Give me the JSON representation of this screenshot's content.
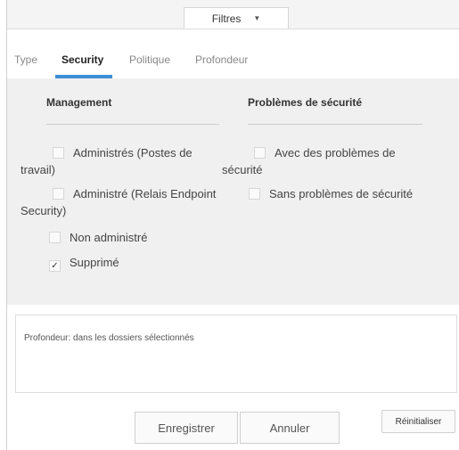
{
  "header": {
    "filter_dropdown": "Filtres",
    "caret_glyph": "▼"
  },
  "tabs": [
    {
      "label": "Type"
    },
    {
      "label": "Security",
      "active": true
    },
    {
      "label": "Politique"
    },
    {
      "label": "Profondeur"
    }
  ],
  "management": {
    "heading": "Management",
    "options": [
      {
        "label": "Administrés (Postes de travail)",
        "checked": false
      },
      {
        "label": "Administré (Relais Endpoint Security)",
        "checked": false
      },
      {
        "label": "Non administré",
        "checked": false
      },
      {
        "label": "Supprimé",
        "checked": true
      }
    ]
  },
  "security_problems": {
    "heading": "Problèmes de sécurité",
    "options": [
      {
        "label": "Avec des problèmes de sécurité",
        "checked": false
      },
      {
        "label": "Sans problèmes de sécurité",
        "checked": false
      }
    ]
  },
  "depth": {
    "text": "Profondeur: dans les dossiers sélectionnés"
  },
  "buttons": {
    "save": "Enregistrer",
    "cancel": "Annuler",
    "reset": "Réinitialiser"
  },
  "checkmark_glyph": "✓",
  "colors": {
    "accent": "#3d8fd6",
    "panel_bg": "#f0f0f0"
  }
}
